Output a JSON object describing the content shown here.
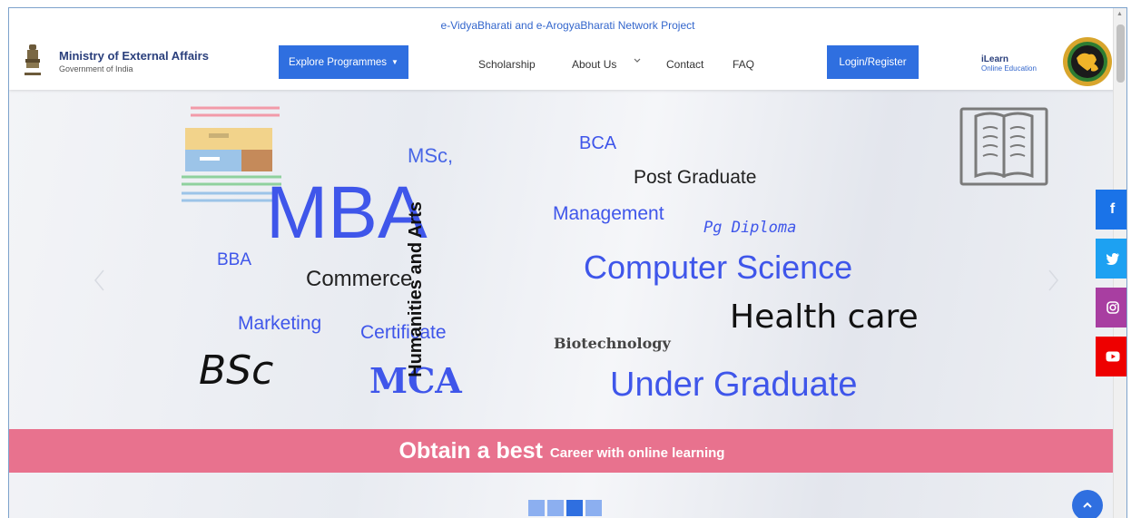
{
  "header": {
    "project_title": "e-VidyaBharati and e-ArogyaBharati Network Project",
    "brand_title": "Ministry of External Affairs",
    "brand_subtitle": "Government of India",
    "explore_label": "Explore Programmes",
    "nav": {
      "scholarship": "Scholarship",
      "about": "About Us",
      "contact": "Contact",
      "faq": "FAQ"
    },
    "login_label": "Login/Register",
    "ilearn_title": "iLearn",
    "ilearn_subtitle": "Online Education"
  },
  "hero": {
    "words": {
      "msc": "MSc,",
      "mba": "MBA",
      "bba": "BBA",
      "commerce": "Commerce",
      "marketing": "Marketing",
      "certificate": "Certificate",
      "bsc": "BSc",
      "mca": "MCA",
      "humanities": "Humanities and Arts",
      "bca": "BCA",
      "post_graduate": "Post Graduate",
      "management": "Management",
      "pg_diploma": "Pg Diploma",
      "computer_science": "Computer Science",
      "health_care": "Health care",
      "biotechnology": "Biotechnology",
      "under_graduate": "Under Graduate"
    },
    "banner_big": "Obtain a best",
    "banner_small": "Career with online learning",
    "slides": {
      "count": 4,
      "active": 3
    }
  },
  "colors": {
    "accent": "#2f6fe0",
    "banner": "#e8728e",
    "facebook": "#1a73e8",
    "twitter": "#1da1f2",
    "instagram": "#a83ea1",
    "youtube": "#ee0000"
  },
  "social": [
    "facebook-icon",
    "twitter-icon",
    "instagram-icon",
    "youtube-icon"
  ]
}
